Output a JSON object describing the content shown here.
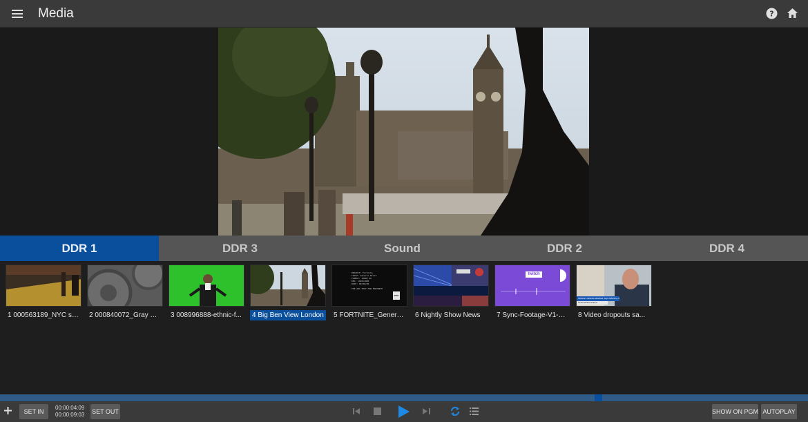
{
  "header": {
    "title": "Media"
  },
  "tabs": [
    {
      "label": "DDR 1",
      "active": true
    },
    {
      "label": "DDR 3",
      "active": false
    },
    {
      "label": "Sound",
      "active": false
    },
    {
      "label": "DDR 2",
      "active": false
    },
    {
      "label": "DDR 4",
      "active": false
    }
  ],
  "clips": [
    {
      "label": "1 000563189_NYC su..."
    },
    {
      "label": "2 000840072_Gray M..."
    },
    {
      "label": "3 008996888-ethnic-f..."
    },
    {
      "label": "4 Big Ben View London",
      "selected": true
    },
    {
      "label": "5 FORTNITE_General_..."
    },
    {
      "label": "6 Nightly Show News"
    },
    {
      "label": "7 Sync-Footage-V1-H..."
    },
    {
      "label": "8 Video dropouts sa..."
    }
  ],
  "thumbnail_text": {
    "twitch": "twitch",
    "fortnite_lines": [
      "PROJECT: Fortnite",
      "TITLE: General Brief",
      "FORMAT: 1080P 60",
      "RES: 1920x1080",
      "DATE: 00/00/00",
      "THE ABC TEST FOR FORTNITE"
    ],
    "fortnite_logo": "EPIC",
    "news_banner": "Ukraine's defense attacked, says cabinet's new stance...",
    "news_subbanner": "Fictional field analyst"
  },
  "transport": {
    "set_in": "SET IN",
    "set_out": "SET OUT",
    "timecode_in": "00:00:04:09",
    "timecode_out": "00:00:09:03",
    "show_on_pgm": "SHOW ON PGM",
    "autoplay": "AUTOPLAY"
  },
  "playback": {
    "position": 0.736
  },
  "colors": {
    "accent": "#0a4f9c",
    "header": "#3a3a3a",
    "play": "#1e88e5"
  }
}
